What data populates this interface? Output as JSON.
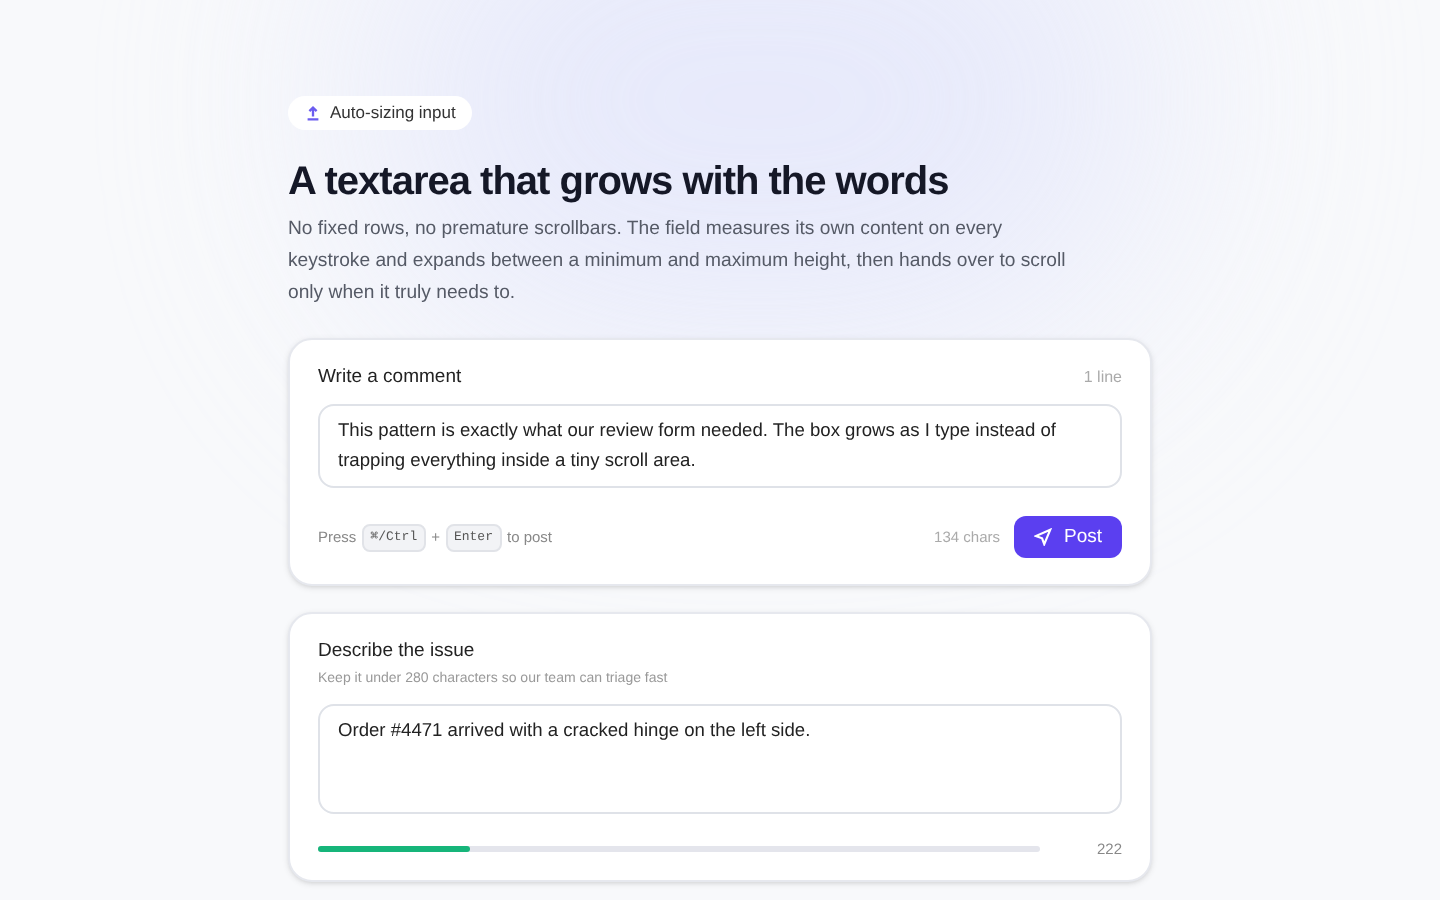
{
  "badge": "Auto-sizing input",
  "title": "A textarea that grows with the words",
  "intro": "No fixed rows, no premature scrollbars. The field measures its own content on every keystroke and expands between a minimum and maximum height, then hands over to scroll only when it truly needs to.",
  "comment": {
    "label": "Write a comment",
    "line_count": "1 line",
    "value": "This pattern is exactly what our review form needed. The box grows as I type instead of trapping everything inside a tiny scroll area.",
    "hint_before": "Press",
    "keys": [
      "⌘/Ctrl",
      "Enter"
    ],
    "key_joiner": "+",
    "hint_after": "to post",
    "char_count": "134 chars",
    "button": "Post"
  },
  "issue": {
    "label": "Describe the issue",
    "help": "Keep it under 280 characters so our team can triage fast",
    "value": "Order #4471 arrived with a cracked hinge on the left side.",
    "level": 0.21,
    "remaining": "222"
  }
}
